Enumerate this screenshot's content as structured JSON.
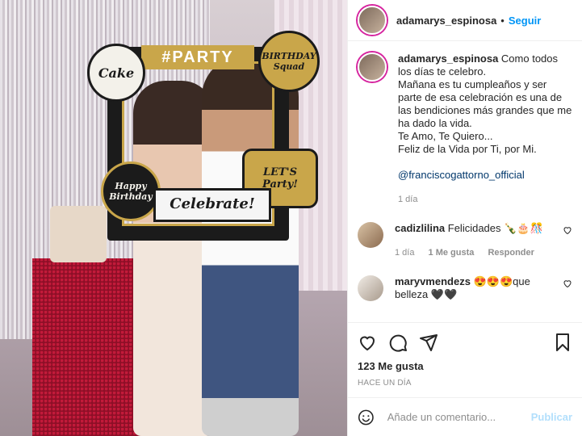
{
  "photo": {
    "frame_banner": "#PARTY",
    "badges": {
      "cake": "Cake",
      "squad": "BIRTHDAY Squad",
      "party": "LET'S Party!",
      "birthday": "Happy Birthday"
    },
    "celebrate": "Celebrate!"
  },
  "header": {
    "username": "adamarys_espinosa",
    "separator": "•",
    "follow_label": "Seguir"
  },
  "caption": {
    "username": "adamarys_espinosa",
    "lines": [
      "Como todos los días te celebro.",
      "Mañana es tu cumpleaños y ser parte de esa celebración es una de las bendiciones más grandes que me ha dado la vida.",
      "Te Amo, Te Quiero...",
      "Feliz de la Vida por Ti, por Mi."
    ],
    "mention": "@franciscogattorno_official",
    "time": "1 día"
  },
  "comments": [
    {
      "username": "cadizlilina",
      "text": "Felicidades 🍾🎂🎊",
      "time": "1 día",
      "likes": "1 Me gusta",
      "reply": "Responder"
    },
    {
      "username": "maryvmendezs",
      "text": "😍😍😍que belleza 🖤🖤"
    }
  ],
  "stats": {
    "likes": "123 Me gusta",
    "ago": "HACE UN DÍA"
  },
  "add_comment": {
    "placeholder": "Añade un comentario...",
    "post_label": "Publicar"
  },
  "colors": {
    "accent": "#0095f6",
    "post_disabled": "#b2dffc",
    "meta": "#8e8e8e"
  },
  "icons": [
    "heart-icon",
    "comment-icon",
    "share-icon",
    "bookmark-icon",
    "emoji-icon"
  ]
}
